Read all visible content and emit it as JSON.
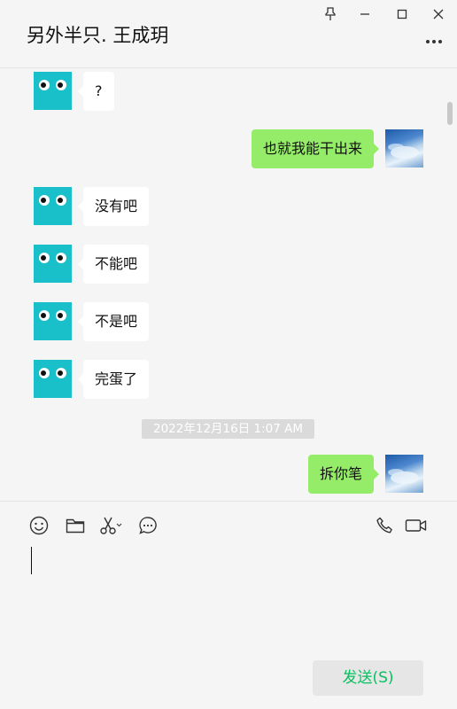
{
  "header": {
    "title": "另外半只. 王成玥"
  },
  "window_controls": [
    "pin-icon",
    "minimize-icon",
    "maximize-icon",
    "close-icon"
  ],
  "messages": [
    {
      "side": "left",
      "text": "?"
    },
    {
      "side": "right",
      "text": "也就我能干出来"
    },
    {
      "side": "left",
      "text": "没有吧"
    },
    {
      "side": "left",
      "text": "不能吧"
    },
    {
      "side": "left",
      "text": "不是吧"
    },
    {
      "side": "left",
      "text": "完蛋了"
    },
    {
      "side": "right",
      "text": "拆你笔"
    }
  ],
  "timestamp": "2022年12月16日 1:07 AM",
  "toolbar": {
    "left_icons": [
      "emoji-icon",
      "folder-icon",
      "scissors-icon",
      "chat-history-icon"
    ],
    "right_icons": [
      "phone-icon",
      "video-icon"
    ]
  },
  "input": {
    "value": "",
    "send_label": "发送(S)"
  },
  "colors": {
    "background": "#f5f5f5",
    "own_bubble": "#95ec69",
    "other_bubble": "#ffffff",
    "owl_avatar": "#19bfc9",
    "send_text": "#07c160"
  }
}
